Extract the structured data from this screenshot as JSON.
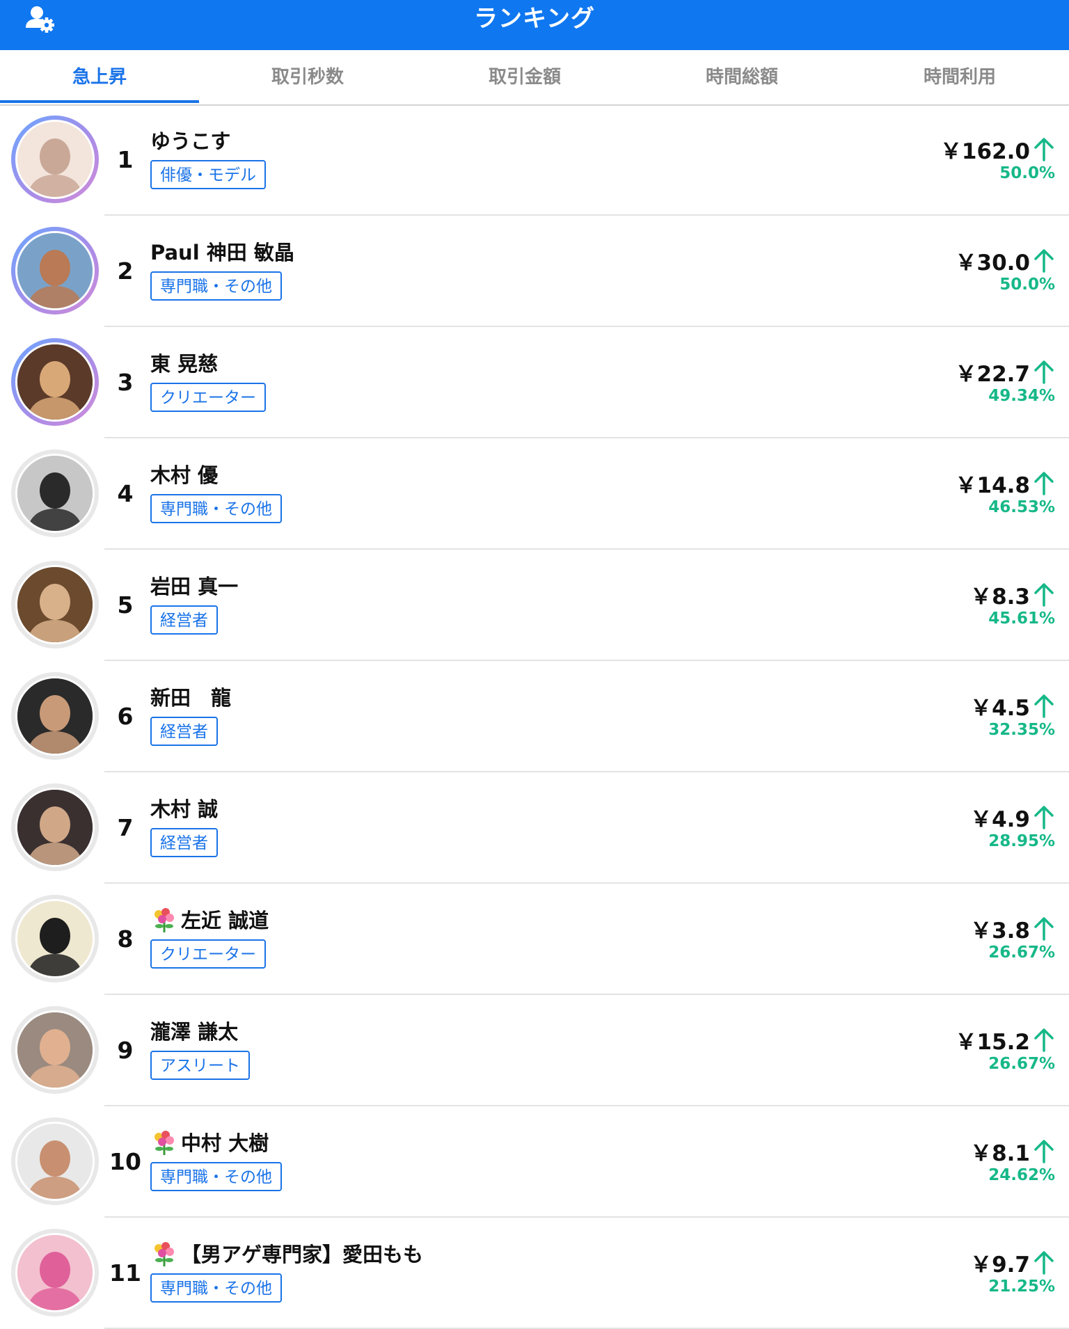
{
  "header": {
    "title": "ランキング",
    "profile_icon": "user-settings-icon"
  },
  "tabs": [
    {
      "label": "急上昇",
      "active": true
    },
    {
      "label": "取引秒数",
      "active": false
    },
    {
      "label": "取引金額",
      "active": false
    },
    {
      "label": "時間総額",
      "active": false
    },
    {
      "label": "時間利用",
      "active": false
    }
  ],
  "colors": {
    "accent": "#1a73e8",
    "header": "#0f77f0",
    "up": "#16b888"
  },
  "rankings": [
    {
      "rank": "1",
      "name": "ゆうこす",
      "tag": "俳優・モデル",
      "price": "￥162.0",
      "change": "50.0%",
      "flower": false,
      "ring": true
    },
    {
      "rank": "2",
      "name": "Paul 神田 敏晶",
      "tag": "専門職・その他",
      "price": "￥30.0",
      "change": "50.0%",
      "flower": false,
      "ring": true
    },
    {
      "rank": "3",
      "name": "東 晃慈",
      "tag": "クリエーター",
      "price": "￥22.7",
      "change": "49.34%",
      "flower": false,
      "ring": true
    },
    {
      "rank": "4",
      "name": "木村 優",
      "tag": "専門職・その他",
      "price": "￥14.8",
      "change": "46.53%",
      "flower": false,
      "ring": false
    },
    {
      "rank": "5",
      "name": "岩田 真一",
      "tag": "経営者",
      "price": "￥8.3",
      "change": "45.61%",
      "flower": false,
      "ring": false
    },
    {
      "rank": "6",
      "name": "新田　龍",
      "tag": "経営者",
      "price": "￥4.5",
      "change": "32.35%",
      "flower": false,
      "ring": false
    },
    {
      "rank": "7",
      "name": "木村 誠",
      "tag": "経営者",
      "price": "￥4.9",
      "change": "28.95%",
      "flower": false,
      "ring": false
    },
    {
      "rank": "8",
      "name": "左近 誠道",
      "tag": "クリエーター",
      "price": "￥3.8",
      "change": "26.67%",
      "flower": true,
      "ring": false
    },
    {
      "rank": "9",
      "name": "瀧澤 謙太",
      "tag": "アスリート",
      "price": "￥15.2",
      "change": "26.67%",
      "flower": false,
      "ring": false
    },
    {
      "rank": "10",
      "name": "中村 大樹",
      "tag": "専門職・その他",
      "price": "￥8.1",
      "change": "24.62%",
      "flower": true,
      "ring": false
    },
    {
      "rank": "11",
      "name": "【男アゲ専門家】愛田もも",
      "tag": "専門職・その他",
      "price": "￥9.7",
      "change": "21.25%",
      "flower": true,
      "ring": false
    }
  ]
}
